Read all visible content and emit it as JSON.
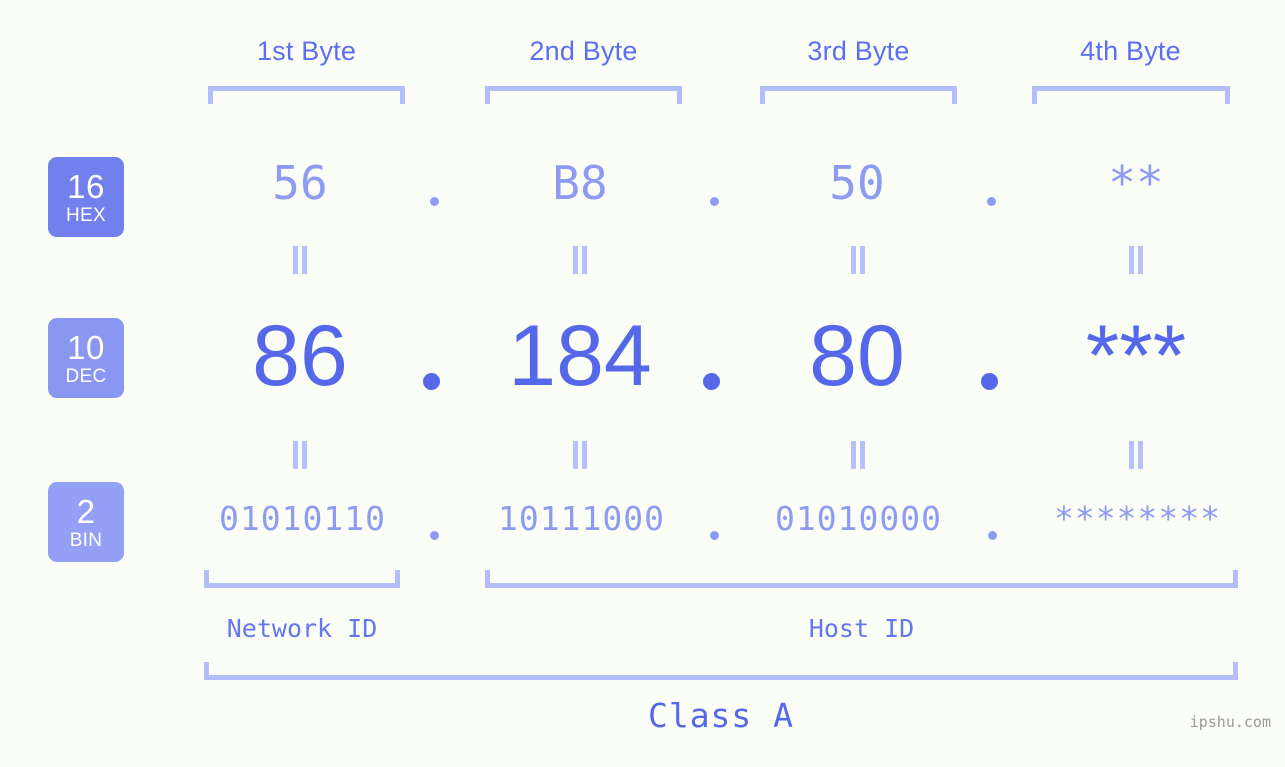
{
  "watermark": "ipshu.com",
  "columns": [
    {
      "header": "1st Byte",
      "hex": "56",
      "dec": "86",
      "bin": "01010110"
    },
    {
      "header": "2nd Byte",
      "hex": "B8",
      "dec": "184",
      "bin": "10111000"
    },
    {
      "header": "3rd Byte",
      "hex": "50",
      "dec": "80",
      "bin": "01010000"
    },
    {
      "header": "4th Byte",
      "hex": "**",
      "dec": "***",
      "bin": "********"
    }
  ],
  "bases": [
    {
      "num": "16",
      "label": "HEX"
    },
    {
      "num": "10",
      "label": "DEC"
    },
    {
      "num": "2",
      "label": "BIN"
    }
  ],
  "separators": {
    "hex": ".",
    "dec": ".",
    "bin": "."
  },
  "segments": [
    {
      "label": "Network ID"
    },
    {
      "label": "Host ID"
    }
  ],
  "class_label": "Class A",
  "colors": {
    "background": "#fbfdf7",
    "accent_strong": "#5568ea",
    "accent_mid": "#8e9bf2",
    "accent_light": "#b3bdfb",
    "badge_hex": "#7180ec",
    "badge_dec": "#8a97f2",
    "badge_bin": "#93a0f6",
    "watermark": "#9a9a9a"
  }
}
